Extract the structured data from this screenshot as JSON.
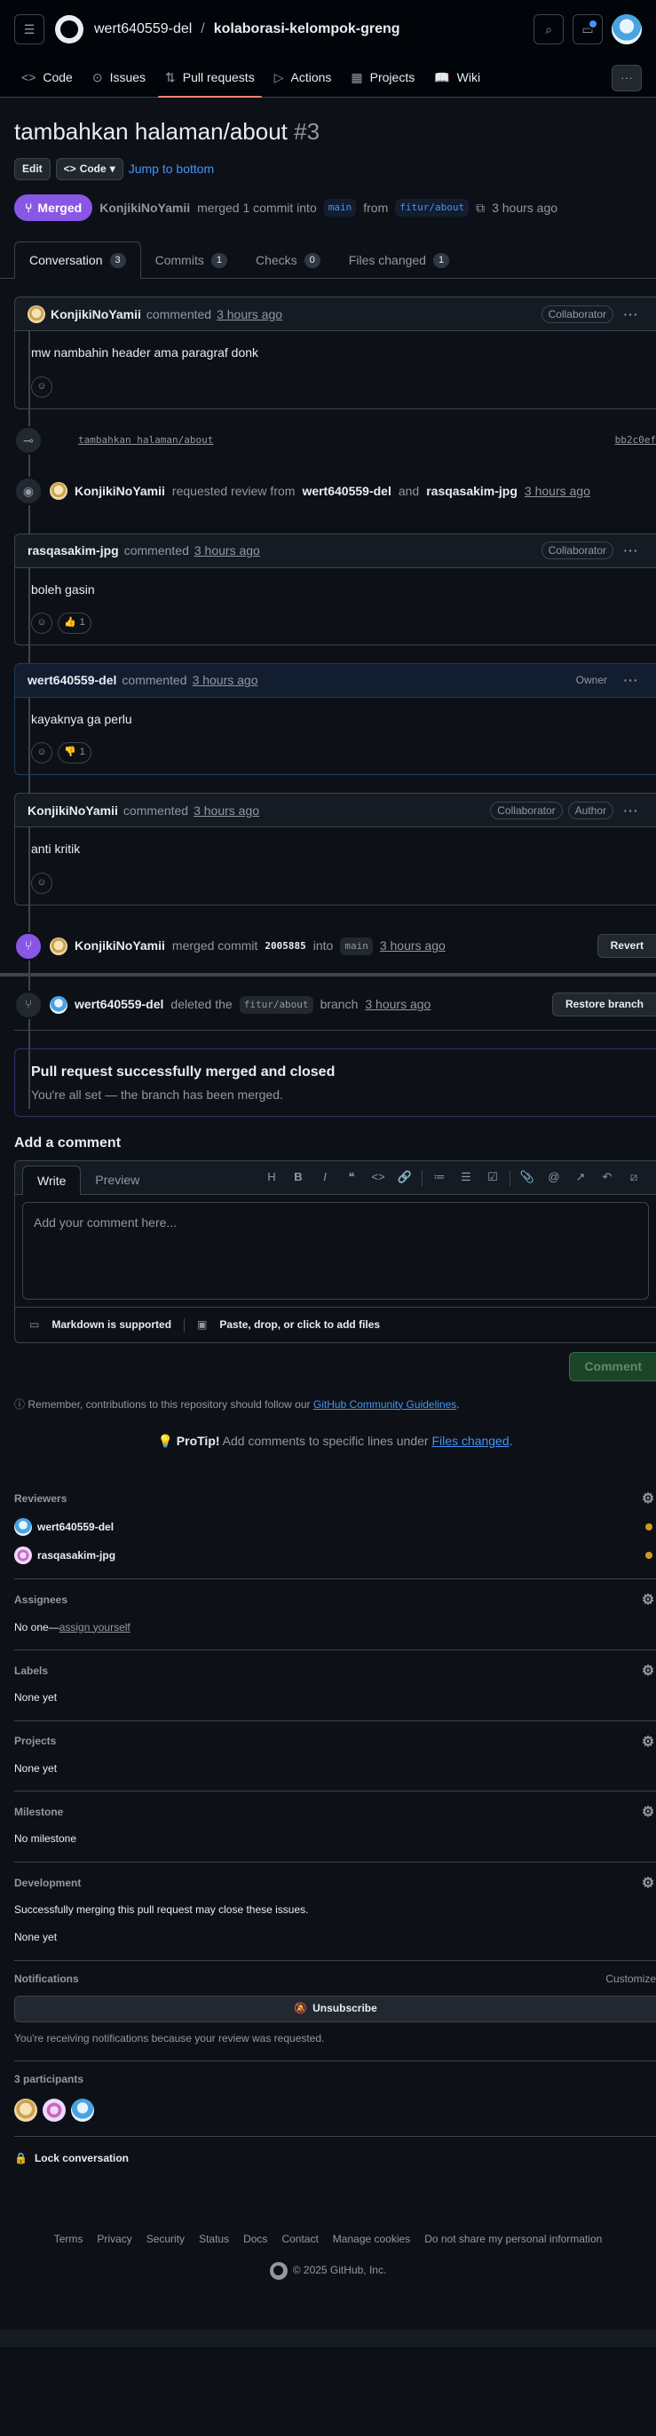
{
  "header": {
    "owner": "wert640559-del",
    "separator": "/",
    "repo": "kolaborasi-kelompok-greng"
  },
  "repo_nav": [
    {
      "label": "Code",
      "icon": "<>"
    },
    {
      "label": "Issues",
      "icon": "⊙"
    },
    {
      "label": "Pull requests",
      "icon": "⇅"
    },
    {
      "label": "Actions",
      "icon": "▷"
    },
    {
      "label": "Projects",
      "icon": "▦"
    },
    {
      "label": "Wiki",
      "icon": "📖"
    }
  ],
  "pr": {
    "title": "tambahkan halaman/about",
    "number": "#3",
    "edit_label": "Edit",
    "code_label": "Code",
    "jump_label": "Jump to bottom",
    "state": "Merged",
    "author": "KonjikiNoYamii",
    "merged_text": "merged 1 commit into",
    "base": "main",
    "from_text": "from",
    "head": "fitur/about",
    "time": "3 hours ago"
  },
  "tabs": [
    {
      "label": "Conversation",
      "count": "3"
    },
    {
      "label": "Commits",
      "count": "1"
    },
    {
      "label": "Checks",
      "count": "0"
    },
    {
      "label": "Files changed",
      "count": "1"
    }
  ],
  "comments": [
    {
      "author": "KonjikiNoYamii",
      "verb": "commented",
      "time": "3 hours ago",
      "role": "Collaborator",
      "body": "mw nambahin header ama paragraf donk",
      "reaction": ""
    },
    {
      "author": "rasqasakim-jpg",
      "verb": "commented",
      "time": "3 hours ago",
      "role": "Collaborator",
      "body": "boleh gasin",
      "reaction_emoji": "👍",
      "reaction_count": "1"
    },
    {
      "author": "wert640559-del",
      "verb": "commented",
      "time": "3 hours ago",
      "role": "Owner",
      "body": "kayaknya ga perlu",
      "reaction_emoji": "👎",
      "reaction_count": "1"
    },
    {
      "author": "KonjikiNoYamii",
      "verb": "commented",
      "time": "3 hours ago",
      "role": "Collaborator",
      "role2": "Author",
      "body": "anti kritik"
    }
  ],
  "commit": {
    "message": "tambahkan halaman/about",
    "sha": "bb2c0ef"
  },
  "review_event": {
    "who": "KonjikiNoYamii",
    "text1": "requested review from",
    "r1": "wert640559-del",
    "and": "and",
    "r2": "rasqasakim-jpg",
    "time": "3 hours ago"
  },
  "merge_event": {
    "who": "KonjikiNoYamii",
    "text1": "merged commit",
    "sha": "2005885",
    "into": "into",
    "branch": "main",
    "time": "3 hours ago",
    "revert_label": "Revert"
  },
  "delete_event": {
    "who": "wert640559-del",
    "text1": "deleted the",
    "branch": "fitur/about",
    "text2": "branch",
    "time": "3 hours ago",
    "restore_label": "Restore branch"
  },
  "merged_box": {
    "heading": "Pull request successfully merged and closed",
    "sub": "You're all set — the branch has been merged."
  },
  "composer": {
    "title": "Add a comment",
    "write": "Write",
    "preview": "Preview",
    "placeholder": "Add your comment here...",
    "markdown": "Markdown is supported",
    "attach": "Paste, drop, or click to add files",
    "submit": "Comment"
  },
  "guidelines": {
    "prefix": "Remember, contributions to this repository should follow our",
    "link": "GitHub Community Guidelines",
    "suffix": "."
  },
  "protip": {
    "label": "ProTip!",
    "text": "Add comments to specific lines under",
    "link": "Files changed",
    "suffix": "."
  },
  "sidebar": {
    "reviewers_title": "Reviewers",
    "reviewers": [
      "wert640559-del",
      "rasqasakim-jpg"
    ],
    "assignees_title": "Assignees",
    "assignees_none": "No one—",
    "assign_yourself": "assign yourself",
    "labels_title": "Labels",
    "labels_val": "None yet",
    "projects_title": "Projects",
    "projects_val": "None yet",
    "milestone_title": "Milestone",
    "milestone_val": "No milestone",
    "development_title": "Development",
    "development_desc": "Successfully merging this pull request may close these issues.",
    "development_val": "None yet",
    "notifications_title": "Notifications",
    "customize": "Customize",
    "unsubscribe": "Unsubscribe",
    "notif_reason": "You're receiving notifications because your review was requested.",
    "participants_title": "3 participants",
    "lock": "Lock conversation"
  },
  "footer": {
    "links": [
      "Terms",
      "Privacy",
      "Security",
      "Status",
      "Docs",
      "Contact",
      "Manage cookies",
      "Do not share my personal information"
    ],
    "copyright": "© 2025 GitHub, Inc."
  }
}
